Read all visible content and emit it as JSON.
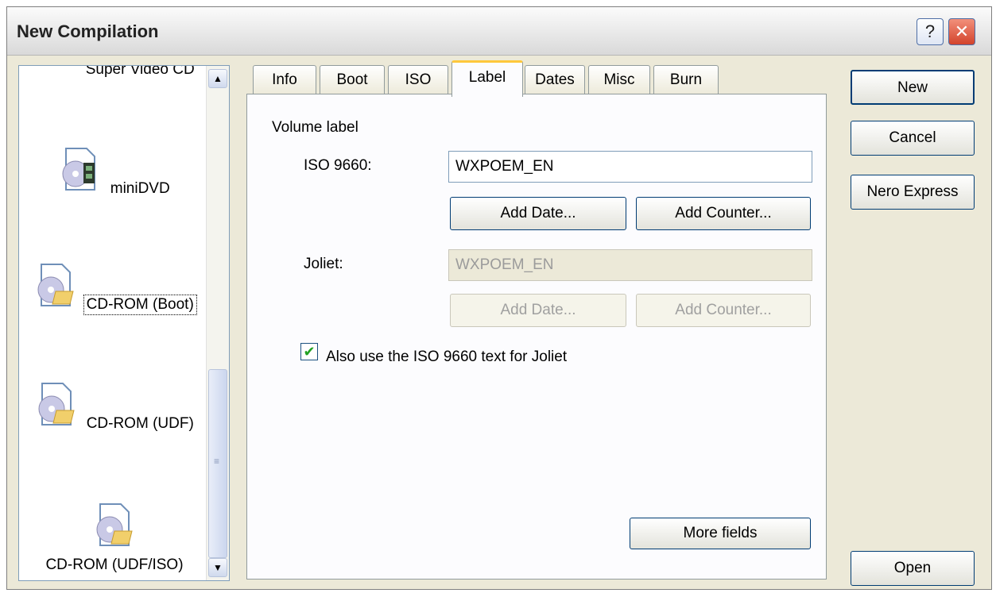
{
  "window": {
    "title": "New Compilation",
    "help_glyph": "?",
    "close_glyph": "✕"
  },
  "formats": [
    {
      "label": "Super Video CD",
      "icon": "video-cd-icon",
      "selected": false
    },
    {
      "label": "miniDVD",
      "icon": "minidvd-icon",
      "selected": false
    },
    {
      "label": "CD-ROM (Boot)",
      "icon": "cdrom-boot-icon",
      "selected": true
    },
    {
      "label": "CD-ROM (UDF)",
      "icon": "cdrom-udf-icon",
      "selected": false
    },
    {
      "label": "CD-ROM (UDF/ISO)",
      "icon": "cdrom-udf-iso-icon",
      "selected": false
    }
  ],
  "scrollbar": {
    "up": "▲",
    "down": "▼",
    "grip": "≡"
  },
  "tabs": [
    "Info",
    "Boot",
    "ISO",
    "Label",
    "Dates",
    "Misc",
    "Burn"
  ],
  "active_tab": "Label",
  "label_panel": {
    "section_title": "Volume label",
    "iso_label": "ISO 9660:",
    "iso_value": "WXPOEM_EN",
    "joliet_label": "Joliet:",
    "joliet_value": "WXPOEM_EN",
    "add_date": "Add Date...",
    "add_counter": "Add Counter...",
    "checkbox_label": "Also use the ISO 9660 text for Joliet",
    "checkbox_checked": true,
    "check_glyph": "✔",
    "more_fields": "More fields"
  },
  "actions": {
    "new": "New",
    "cancel": "Cancel",
    "nero_express": "Nero Express",
    "open": "Open"
  }
}
